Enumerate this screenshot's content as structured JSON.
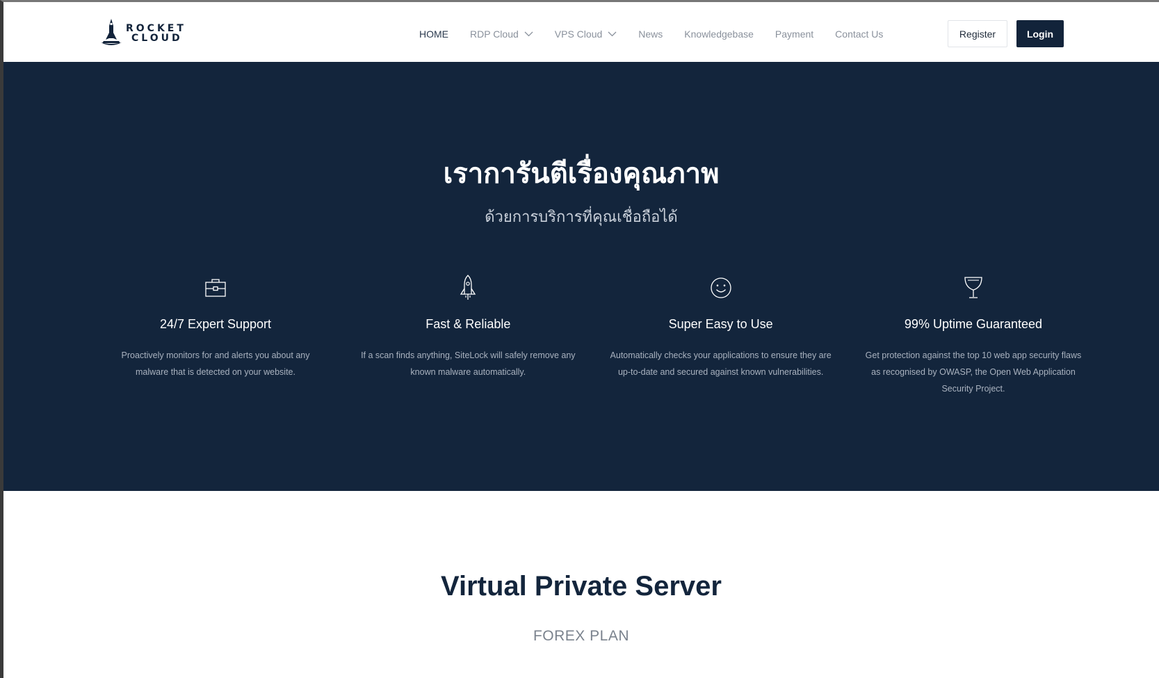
{
  "brand": {
    "line1": "ROCKET",
    "line2": "CLOUD",
    "logo_icon": "rocket-icon",
    "color_dark": "#13253c"
  },
  "nav": {
    "items": [
      {
        "label": "HOME",
        "active": true
      },
      {
        "label": "RDP Cloud",
        "dropdown": true
      },
      {
        "label": "VPS Cloud",
        "dropdown": true
      },
      {
        "label": "News"
      },
      {
        "label": "Knowledgebase"
      },
      {
        "label": "Payment"
      },
      {
        "label": "Contact Us"
      }
    ],
    "register_label": "Register",
    "login_label": "Login"
  },
  "hero": {
    "title": "เราการันตีเรื่องคุณภาพ",
    "subtitle": "ด้วยการบริการที่คุณเชื่อถือได้",
    "features": [
      {
        "icon": "briefcase-icon",
        "title": "24/7 Expert Support",
        "text": "Proactively monitors for and alerts you about any malware that is detected on your website."
      },
      {
        "icon": "rocket-icon",
        "title": "Fast & Reliable",
        "text": "If a scan finds anything, SiteLock will safely remove any known malware automatically."
      },
      {
        "icon": "smiley-icon",
        "title": "Super Easy to Use",
        "text": "Automatically checks your applications to ensure they are up-to-date and secured against known vulnerabilities."
      },
      {
        "icon": "trophy-icon",
        "title": "99% Uptime Guaranteed",
        "text": "Get protection against the top 10 web app security flaws as recognised by OWASP, the Open Web Application Security Project."
      }
    ]
  },
  "section": {
    "title": "Virtual Private Server",
    "subtitle": "FOREX PLAN"
  }
}
